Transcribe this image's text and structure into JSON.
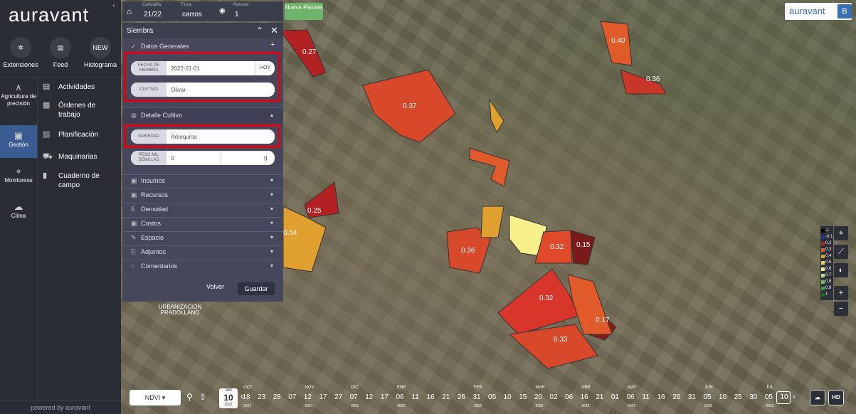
{
  "brand": {
    "logo": "auravant",
    "powered": "powered by auravant",
    "right_logo": "auravant",
    "avatar": "B"
  },
  "top_icons": [
    {
      "label": "Extensiones",
      "icon": "puzzle-icon"
    },
    {
      "label": "Feed",
      "icon": "chat-icon"
    },
    {
      "label": "Histograma",
      "badge": "NEW"
    }
  ],
  "left_nav": [
    {
      "label": "Agricultura de precisión",
      "icon": "wave-icon"
    },
    {
      "label": "Gestión",
      "icon": "clipboard-icon",
      "active": true
    },
    {
      "label": "Monitoreos",
      "icon": "pin-icon"
    },
    {
      "label": "Clima",
      "icon": "cloud-icon"
    }
  ],
  "menu": [
    "Actividades",
    "Órdenes de trabajo",
    "Planificación",
    "Maquinarias",
    "Cuaderno de campo"
  ],
  "topbar": {
    "campaign_label": "Campaña:",
    "campaign": "21/22",
    "farm_label": "Finca:",
    "farm": "carros",
    "plot_label": "Parcela:",
    "plot": "1",
    "new_plot": "Nueva Parcela"
  },
  "panel": {
    "title": "Siembra",
    "general": "Datos Generales",
    "sowing_date_label": "FECHA DE SIEMBRA",
    "sowing_date": "2022-01-01",
    "today": "HOY",
    "crop_label": "CULTIVO",
    "crop": "Olivar",
    "crop_detail": "Detalle Cultivo",
    "variety_label": "VARIEDAD",
    "variety": "Arbequina",
    "seed_weight_label": "PESO MIL SEMILLAS",
    "seed_weight": "0",
    "seed_unit": "g",
    "sections": [
      "Insumos",
      "Recursos",
      "Densidad",
      "Costos",
      "Espacio",
      "Adjuntos",
      "Comentarios"
    ],
    "cancel": "Volver",
    "save": "Guardar"
  },
  "map": {
    "values": [
      "0.27",
      "0.40",
      "0.36",
      "0.37",
      "0.25",
      "0.54",
      "0.36",
      "0.32",
      "0.15",
      "0.32",
      "0.17",
      "0.33"
    ],
    "place": "URBANIZACIÓN PRADOLLANO"
  },
  "legend": [
    {
      "label": "-1",
      "color": "#000000"
    },
    {
      "label": "-0.1",
      "color": "#2233aa"
    },
    {
      "label": "0.2",
      "color": "#b22222"
    },
    {
      "label": "0.3",
      "color": "#e05a2a"
    },
    {
      "label": "0.4",
      "color": "#e0a030"
    },
    {
      "label": "0.5",
      "color": "#f0d050"
    },
    {
      "label": "0.6",
      "color": "#f8f08a"
    },
    {
      "label": "0.7",
      "color": "#b8e08a"
    },
    {
      "label": "0.8",
      "color": "#70c060"
    },
    {
      "label": "0.9",
      "color": "#30a040"
    },
    {
      "label": "1",
      "color": "#0a6a20"
    }
  ],
  "timeline": {
    "index": "NDVI",
    "cal_month": "JAN",
    "cal_day": "10",
    "cal_year": "2022",
    "months": [
      "OCT",
      "NOV",
      "DIC",
      "ENE",
      "FEB",
      "MAR",
      "ABR",
      "MAY",
      "JUN",
      "JUL"
    ],
    "years": [
      "2021",
      "2021",
      "2021",
      "2022",
      "2022",
      "2022",
      "2022",
      "2022",
      "2022",
      "2022"
    ],
    "days": [
      "18",
      "23",
      "28",
      "07",
      "12",
      "17",
      "27",
      "07",
      "12",
      "17",
      "06",
      "11",
      "16",
      "21",
      "26",
      "31",
      "05",
      "10",
      "15",
      "20",
      "02",
      "06",
      "16",
      "21",
      "01",
      "06",
      "11",
      "16",
      "26",
      "31",
      "05",
      "10",
      "25",
      "30",
      "05",
      "10"
    ],
    "hd": "HD"
  }
}
